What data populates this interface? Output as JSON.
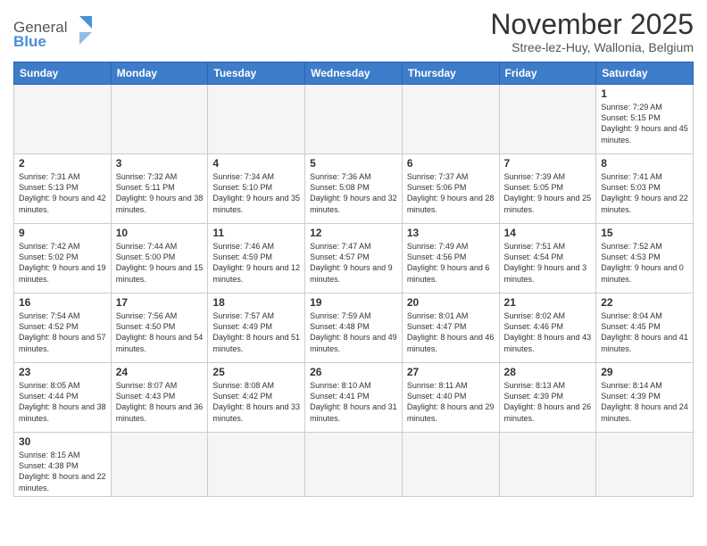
{
  "logo": {
    "text_general": "General",
    "text_blue": "Blue"
  },
  "header": {
    "month_title": "November 2025",
    "subtitle": "Stree-lez-Huy, Wallonia, Belgium"
  },
  "weekdays": [
    "Sunday",
    "Monday",
    "Tuesday",
    "Wednesday",
    "Thursday",
    "Friday",
    "Saturday"
  ],
  "weeks": [
    [
      {
        "day": "",
        "info": ""
      },
      {
        "day": "",
        "info": ""
      },
      {
        "day": "",
        "info": ""
      },
      {
        "day": "",
        "info": ""
      },
      {
        "day": "",
        "info": ""
      },
      {
        "day": "",
        "info": ""
      },
      {
        "day": "1",
        "info": "Sunrise: 7:29 AM\nSunset: 5:15 PM\nDaylight: 9 hours and 45 minutes."
      }
    ],
    [
      {
        "day": "2",
        "info": "Sunrise: 7:31 AM\nSunset: 5:13 PM\nDaylight: 9 hours and 42 minutes."
      },
      {
        "day": "3",
        "info": "Sunrise: 7:32 AM\nSunset: 5:11 PM\nDaylight: 9 hours and 38 minutes."
      },
      {
        "day": "4",
        "info": "Sunrise: 7:34 AM\nSunset: 5:10 PM\nDaylight: 9 hours and 35 minutes."
      },
      {
        "day": "5",
        "info": "Sunrise: 7:36 AM\nSunset: 5:08 PM\nDaylight: 9 hours and 32 minutes."
      },
      {
        "day": "6",
        "info": "Sunrise: 7:37 AM\nSunset: 5:06 PM\nDaylight: 9 hours and 28 minutes."
      },
      {
        "day": "7",
        "info": "Sunrise: 7:39 AM\nSunset: 5:05 PM\nDaylight: 9 hours and 25 minutes."
      },
      {
        "day": "8",
        "info": "Sunrise: 7:41 AM\nSunset: 5:03 PM\nDaylight: 9 hours and 22 minutes."
      }
    ],
    [
      {
        "day": "9",
        "info": "Sunrise: 7:42 AM\nSunset: 5:02 PM\nDaylight: 9 hours and 19 minutes."
      },
      {
        "day": "10",
        "info": "Sunrise: 7:44 AM\nSunset: 5:00 PM\nDaylight: 9 hours and 15 minutes."
      },
      {
        "day": "11",
        "info": "Sunrise: 7:46 AM\nSunset: 4:59 PM\nDaylight: 9 hours and 12 minutes."
      },
      {
        "day": "12",
        "info": "Sunrise: 7:47 AM\nSunset: 4:57 PM\nDaylight: 9 hours and 9 minutes."
      },
      {
        "day": "13",
        "info": "Sunrise: 7:49 AM\nSunset: 4:56 PM\nDaylight: 9 hours and 6 minutes."
      },
      {
        "day": "14",
        "info": "Sunrise: 7:51 AM\nSunset: 4:54 PM\nDaylight: 9 hours and 3 minutes."
      },
      {
        "day": "15",
        "info": "Sunrise: 7:52 AM\nSunset: 4:53 PM\nDaylight: 9 hours and 0 minutes."
      }
    ],
    [
      {
        "day": "16",
        "info": "Sunrise: 7:54 AM\nSunset: 4:52 PM\nDaylight: 8 hours and 57 minutes."
      },
      {
        "day": "17",
        "info": "Sunrise: 7:56 AM\nSunset: 4:50 PM\nDaylight: 8 hours and 54 minutes."
      },
      {
        "day": "18",
        "info": "Sunrise: 7:57 AM\nSunset: 4:49 PM\nDaylight: 8 hours and 51 minutes."
      },
      {
        "day": "19",
        "info": "Sunrise: 7:59 AM\nSunset: 4:48 PM\nDaylight: 8 hours and 49 minutes."
      },
      {
        "day": "20",
        "info": "Sunrise: 8:01 AM\nSunset: 4:47 PM\nDaylight: 8 hours and 46 minutes."
      },
      {
        "day": "21",
        "info": "Sunrise: 8:02 AM\nSunset: 4:46 PM\nDaylight: 8 hours and 43 minutes."
      },
      {
        "day": "22",
        "info": "Sunrise: 8:04 AM\nSunset: 4:45 PM\nDaylight: 8 hours and 41 minutes."
      }
    ],
    [
      {
        "day": "23",
        "info": "Sunrise: 8:05 AM\nSunset: 4:44 PM\nDaylight: 8 hours and 38 minutes."
      },
      {
        "day": "24",
        "info": "Sunrise: 8:07 AM\nSunset: 4:43 PM\nDaylight: 8 hours and 36 minutes."
      },
      {
        "day": "25",
        "info": "Sunrise: 8:08 AM\nSunset: 4:42 PM\nDaylight: 8 hours and 33 minutes."
      },
      {
        "day": "26",
        "info": "Sunrise: 8:10 AM\nSunset: 4:41 PM\nDaylight: 8 hours and 31 minutes."
      },
      {
        "day": "27",
        "info": "Sunrise: 8:11 AM\nSunset: 4:40 PM\nDaylight: 8 hours and 29 minutes."
      },
      {
        "day": "28",
        "info": "Sunrise: 8:13 AM\nSunset: 4:39 PM\nDaylight: 8 hours and 26 minutes."
      },
      {
        "day": "29",
        "info": "Sunrise: 8:14 AM\nSunset: 4:39 PM\nDaylight: 8 hours and 24 minutes."
      }
    ],
    [
      {
        "day": "30",
        "info": "Sunrise: 8:15 AM\nSunset: 4:38 PM\nDaylight: 8 hours and 22 minutes."
      },
      {
        "day": "",
        "info": ""
      },
      {
        "day": "",
        "info": ""
      },
      {
        "day": "",
        "info": ""
      },
      {
        "day": "",
        "info": ""
      },
      {
        "day": "",
        "info": ""
      },
      {
        "day": "",
        "info": ""
      }
    ]
  ]
}
